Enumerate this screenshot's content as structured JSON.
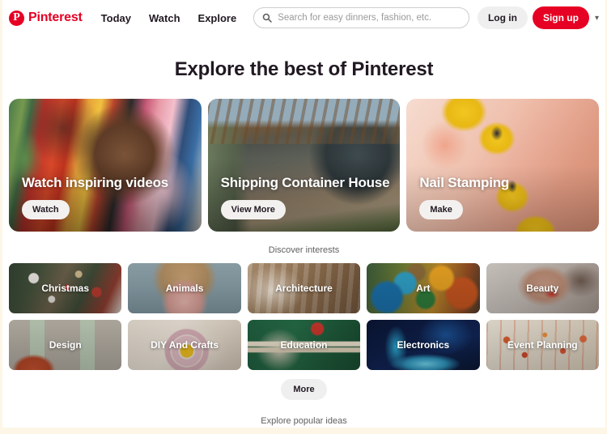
{
  "header": {
    "logo_icon": "pinterest-logo-icon",
    "brand": "Pinterest",
    "brand_color": "#e60023",
    "nav": [
      {
        "label": "Today"
      },
      {
        "label": "Watch"
      },
      {
        "label": "Explore"
      }
    ],
    "search": {
      "icon": "search-icon",
      "placeholder": "Search for easy dinners, fashion, etc.",
      "value": ""
    },
    "login_label": "Log in",
    "signup_label": "Sign up",
    "signup_color": "#e60023",
    "chevron_icon": "chevron-down-icon"
  },
  "main": {
    "page_title": "Explore the best of Pinterest",
    "hero_cards": [
      {
        "title": "Watch inspiring videos",
        "button": "Watch",
        "art": "colorful-mural-portrait"
      },
      {
        "title": "Shipping Container House",
        "button": "View More",
        "art": "wooden-pergola-house"
      },
      {
        "title": "Nail Stamping",
        "button": "Make",
        "art": "yellow-nails-floral-stamp"
      }
    ],
    "discover_label": "Discover interests",
    "interests": [
      {
        "label": "Christmas",
        "art": "christmas-wreath"
      },
      {
        "label": "Animals",
        "art": "dog-portrait"
      },
      {
        "label": "Architecture",
        "art": "curved-wood-arches"
      },
      {
        "label": "Art",
        "art": "paint-palette"
      },
      {
        "label": "Beauty",
        "art": "makeup-portrait"
      },
      {
        "label": "Design",
        "art": "abstract-shapes"
      },
      {
        "label": "DIY And Crafts",
        "art": "crochet-rainbow"
      },
      {
        "label": "Education",
        "art": "books-and-apple"
      },
      {
        "label": "Electronics",
        "art": "blue-circuit"
      },
      {
        "label": "Event Planning",
        "art": "hanging-decorations"
      }
    ],
    "more_label": "More",
    "bottom_label": "Explore popular ideas"
  }
}
